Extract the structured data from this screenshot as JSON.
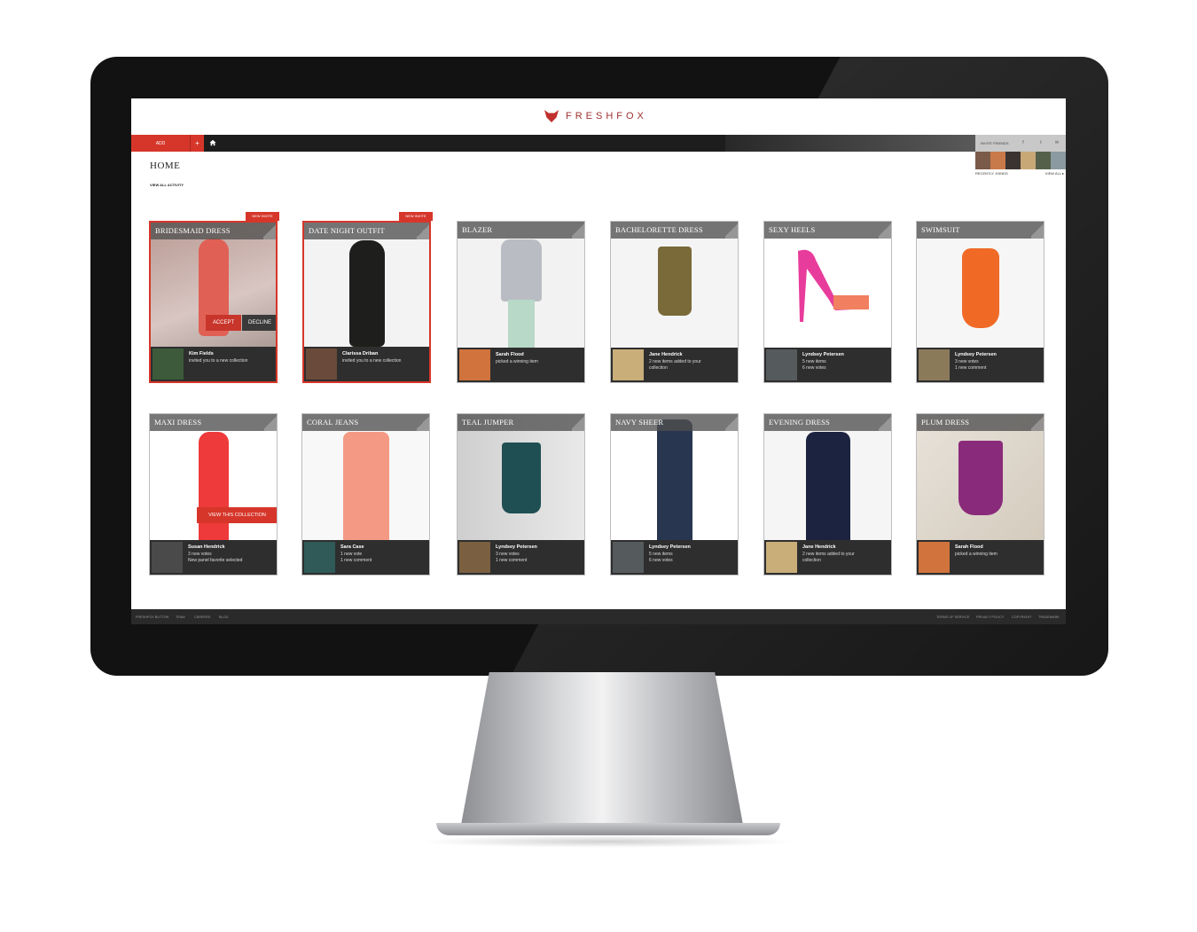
{
  "header": {
    "logo_text": "FRESHFOX"
  },
  "nav": {
    "add_label": "ADD",
    "plus_label": "+"
  },
  "invite_panel": {
    "label": "INVITE FRIENDS",
    "social": [
      "f",
      "t",
      "✉"
    ],
    "recently_joined": "RECENTLY JOINED",
    "view_all": "VIEW ALL ▸"
  },
  "page": {
    "title": "HOME",
    "view_all_activity": "VIEW ALL ACTIVITY"
  },
  "actions": {
    "accept": "ACCEPT",
    "decline": "DECLINE",
    "new_invite": "NEW INVITE",
    "view_collection": "VIEW THIS COLLECTION"
  },
  "cards": [
    {
      "title": "BRIDESMAID DRESS",
      "user": "Kim Fields",
      "line1": "invited you to a new collection",
      "line2": ""
    },
    {
      "title": "DATE NIGHT OUTFIT",
      "user": "Clarissa Driban",
      "line1": "invited you to a new collection",
      "line2": ""
    },
    {
      "title": "BLAZER",
      "user": "Sarah Flood",
      "line1": "picked a winning item",
      "line2": ""
    },
    {
      "title": "BACHELORETTE DRESS",
      "user": "Jane Hendrick",
      "line1": "2 new items added to your",
      "line2": "collection"
    },
    {
      "title": "SEXY HEELS",
      "user": "Lyndsey Petersen",
      "line1": "5 new items",
      "line2": "6 new votes"
    },
    {
      "title": "SWIMSUIT",
      "user": "Lyndsey Petersen",
      "line1": "3 new votes",
      "line2": "1 new comment"
    },
    {
      "title": "MAXI DRESS",
      "user": "Susan Hendrick",
      "line1": "3 new votes",
      "line2": "New panel favorite selected"
    },
    {
      "title": "CORAL JEANS",
      "user": "Sara Case",
      "line1": "1 new vote",
      "line2": "1 new comment"
    },
    {
      "title": "TEAL JUMPER",
      "user": "Lyndsey Petersen",
      "line1": "3 new votes",
      "line2": "1 new comment"
    },
    {
      "title": "NAVY SHEER",
      "user": "Lyndsey Petersen",
      "line1": "5 new items",
      "line2": "6 new votes"
    },
    {
      "title": "EVENING DRESS",
      "user": "Jane Hendrick",
      "line1": "2 new items added to your",
      "line2": "collection"
    },
    {
      "title": "PLUM DRESS",
      "user": "Sarah Flood",
      "line1": "picked a winning item",
      "line2": ""
    }
  ],
  "footer": {
    "left_links": [
      "FRESHFOX BUTTON",
      "TEAM",
      "CAREERS",
      "BLOG"
    ],
    "right_links": [
      "TERMS OF SERVICE",
      "PRIVACY POLICY",
      "COPYRIGHT",
      "TRADEMARK"
    ]
  },
  "colors": {
    "accent": "#d6362a",
    "nav_bg": "#1d1d1d",
    "card_footer": "#2e2e2e"
  }
}
